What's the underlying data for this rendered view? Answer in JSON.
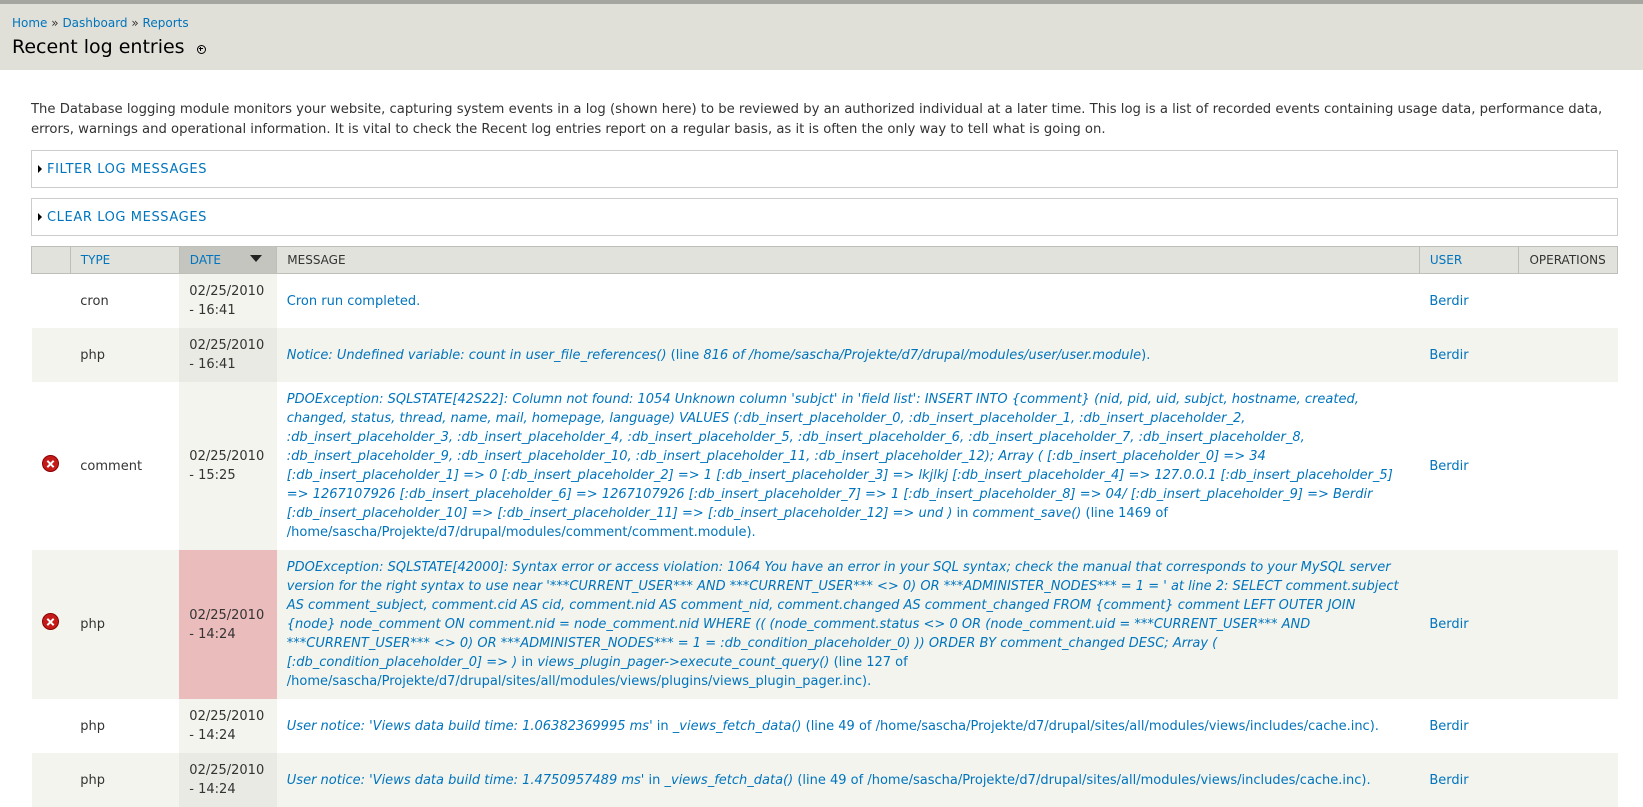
{
  "breadcrumb": [
    "Home",
    "Dashboard",
    "Reports"
  ],
  "breadcrumb_sep": "»",
  "page_title": "Recent log entries",
  "intro": "The Database logging module monitors your website, capturing system events in a log (shown here) to be reviewed by an authorized individual at a later time. This log is a list of recorded events containing usage data, performance data, errors, warnings and operational information. It is vital to check the Recent log entries report on a regular basis, as it is often the only way to tell what is going on.",
  "fieldsets": {
    "filter": "FILTER LOG MESSAGES",
    "clear": "CLEAR LOG MESSAGES"
  },
  "table": {
    "headers": {
      "type": "TYPE",
      "date": "DATE",
      "message": "MESSAGE",
      "user": "USER",
      "operations": "OPERATIONS"
    },
    "rows": [
      {
        "icon": "",
        "type": "cron",
        "date": [
          "02/25/2010",
          "- 16:41"
        ],
        "message": {
          "pre": "",
          "em1": "",
          "mid": "Cron run completed.",
          "em2": "",
          "post": ""
        },
        "user": "Berdir"
      },
      {
        "icon": "",
        "type": "php",
        "date": [
          "02/25/2010",
          "- 16:41"
        ],
        "message": {
          "pre": "",
          "em1": "Notice: Undefined variable: count in user_file_references()",
          "mid": " (line ",
          "em2": "816 of /home/sascha/Projekte/d7/drupal/modules/user/user.module",
          "post": ")."
        },
        "user": "Berdir"
      },
      {
        "icon": "error-icon",
        "type": "comment",
        "date": [
          "02/25/2010",
          "- 15:25"
        ],
        "message": {
          "pre": "",
          "em1": "PDOException: SQLSTATE[42S22]: Column not found: 1054 Unknown column 'subjct' in 'field list': INSERT INTO {comment} (nid, pid, uid, subjct, hostname, created, changed, status, thread, name, mail, homepage, language) VALUES (:db_insert_placeholder_0, :db_insert_placeholder_1, :db_insert_placeholder_2, :db_insert_placeholder_3, :db_insert_placeholder_4, :db_insert_placeholder_5, :db_insert_placeholder_6, :db_insert_placeholder_7, :db_insert_placeholder_8, :db_insert_placeholder_9, :db_insert_placeholder_10, :db_insert_placeholder_11, :db_insert_placeholder_12); Array ( [:db_insert_placeholder_0] => 34 [:db_insert_placeholder_1] => 0 [:db_insert_placeholder_2] => 1 [:db_insert_placeholder_3] => lkjlkj [:db_insert_placeholder_4] => 127.0.0.1 [:db_insert_placeholder_5] => 1267107926 [:db_insert_placeholder_6] => 1267107926 [:db_insert_placeholder_7] => 1 [:db_insert_placeholder_8] => 04/ [:db_insert_placeholder_9] => Berdir [:db_insert_placeholder_10] => [:db_insert_placeholder_11] => [:db_insert_placeholder_12] => und )",
          "mid": " in ",
          "em2": "comment_save()",
          "post": " (line 1469 of /home/sascha/Projekte/d7/drupal/modules/comment/comment.module)."
        },
        "user": "Berdir"
      },
      {
        "icon": "error-icon",
        "type": "php",
        "date": [
          "02/25/2010",
          "- 14:24"
        ],
        "message": {
          "pre": "",
          "em1": "PDOException: SQLSTATE[42000]: Syntax error or access violation: 1064 You have an error in your SQL syntax; check the manual that corresponds to your MySQL server version for the right syntax to use near '***CURRENT_USER*** AND ***CURRENT_USER*** <> 0) OR ***ADMINISTER_NODES*** = 1 = ' at line 2: SELECT comment.subject AS comment_subject, comment.cid AS cid, comment.nid AS comment_nid, comment.changed AS comment_changed FROM {comment} comment LEFT OUTER JOIN {node} node_comment ON comment.nid = node_comment.nid WHERE (( (node_comment.status <> 0 OR (node_comment.uid = ***CURRENT_USER*** AND ***CURRENT_USER*** <> 0) OR ***ADMINISTER_NODES*** = 1 = :db_condition_placeholder_0) )) ORDER BY comment_changed DESC; Array ( [:db_condition_placeholder_0] => )",
          "mid": " in ",
          "em2": "views_plugin_pager->execute_count_query()",
          "post": " (line 127 of /home/sascha/Projekte/d7/drupal/sites/all/modules/views/plugins/views_plugin_pager.inc)."
        },
        "user": "Berdir"
      },
      {
        "icon": "",
        "type": "php",
        "date": [
          "02/25/2010",
          "- 14:24"
        ],
        "message": {
          "pre": "",
          "em1": "User notice: 'Views data build time: 1.06382369995 ms'",
          "mid": " in ",
          "em2": "_views_fetch_data()",
          "post": " (line 49 of /home/sascha/Projekte/d7/drupal/sites/all/modules/views/includes/cache.inc)."
        },
        "user": "Berdir"
      },
      {
        "icon": "",
        "type": "php",
        "date": [
          "02/25/2010",
          "- 14:24"
        ],
        "message": {
          "pre": "",
          "em1": "User notice: 'Views data build time: 1.4750957489 ms'",
          "mid": " in ",
          "em2": "_views_fetch_data()",
          "post": " (line 49 of /home/sascha/Projekte/d7/drupal/sites/all/modules/views/includes/cache.inc)."
        },
        "user": "Berdir"
      }
    ]
  }
}
